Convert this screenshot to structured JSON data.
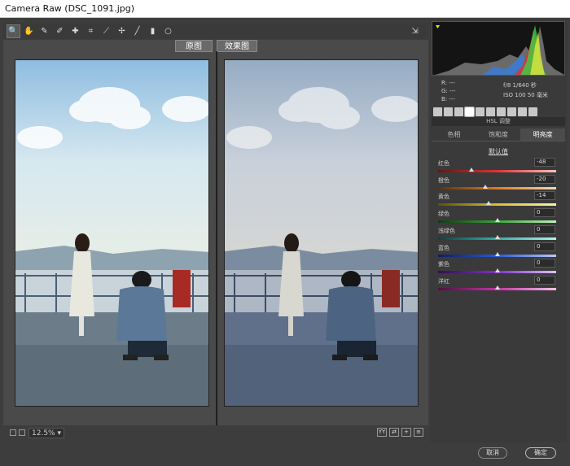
{
  "window": {
    "title": "Camera Raw (DSC_1091.jpg)"
  },
  "toolbar": {
    "tools": [
      {
        "name": "zoom-tool",
        "glyph": "🔍"
      },
      {
        "name": "hand-tool",
        "glyph": "✋"
      },
      {
        "name": "white-balance-tool",
        "glyph": "✎"
      },
      {
        "name": "color-sampler-tool",
        "glyph": "✐"
      },
      {
        "name": "targeted-adjustment-tool",
        "glyph": "✚"
      },
      {
        "name": "crop-tool",
        "glyph": "⌗"
      },
      {
        "name": "straighten-tool",
        "glyph": "⟋"
      },
      {
        "name": "spot-removal-tool",
        "glyph": "✢"
      },
      {
        "name": "adjustment-brush-tool",
        "glyph": "╱"
      },
      {
        "name": "graduated-filter-tool",
        "glyph": "▮"
      },
      {
        "name": "radial-filter-tool",
        "glyph": "○"
      }
    ],
    "open_full_glyph": "⇲"
  },
  "preview": {
    "before_label": "原图",
    "after_label": "效果图"
  },
  "status": {
    "zoom": "12.5%",
    "zoom_caret": "▾"
  },
  "histogram": {
    "info_left": [
      "R: ---",
      "G: ---",
      "B: ---"
    ],
    "info_right": [
      "f/8  1/640 秒",
      "ISO 100  50 毫米"
    ]
  },
  "panel": {
    "header": "HSL 调整",
    "tabs": [
      "色相",
      "饱和度",
      "明亮度"
    ],
    "active_tab": 2,
    "subtitle": "默认值"
  },
  "sliders": [
    {
      "label": "红色",
      "value": "-48",
      "pos": 0.28,
      "gradient": "linear-gradient(90deg,#5a1a1a,#d33,#f7c0c0)"
    },
    {
      "label": "橙色",
      "value": "-20",
      "pos": 0.4,
      "gradient": "linear-gradient(90deg,#5a3210,#e07a20,#f7d6b0)"
    },
    {
      "label": "黄色",
      "value": "-14",
      "pos": 0.43,
      "gradient": "linear-gradient(90deg,#5a5010,#d8c030,#f8f0b0)"
    },
    {
      "label": "绿色",
      "value": "0",
      "pos": 0.5,
      "gradient": "linear-gradient(90deg,#143a14,#3aa23a,#b8f0b8)"
    },
    {
      "label": "浅绿色",
      "value": "0",
      "pos": 0.5,
      "gradient": "linear-gradient(90deg,#10403e,#30b0a8,#b0f0ec)"
    },
    {
      "label": "蓝色",
      "value": "0",
      "pos": 0.5,
      "gradient": "linear-gradient(90deg,#101e5a,#2a58d8,#b8c8f8)"
    },
    {
      "label": "紫色",
      "value": "0",
      "pos": 0.5,
      "gradient": "linear-gradient(90deg,#321050,#8030c8,#dcc0f4)"
    },
    {
      "label": "洋红",
      "value": "0",
      "pos": 0.5,
      "gradient": "linear-gradient(90deg,#50103e,#c830a8,#f4c0e8)"
    }
  ],
  "buttons": {
    "cancel": "取消",
    "ok": "确定"
  }
}
